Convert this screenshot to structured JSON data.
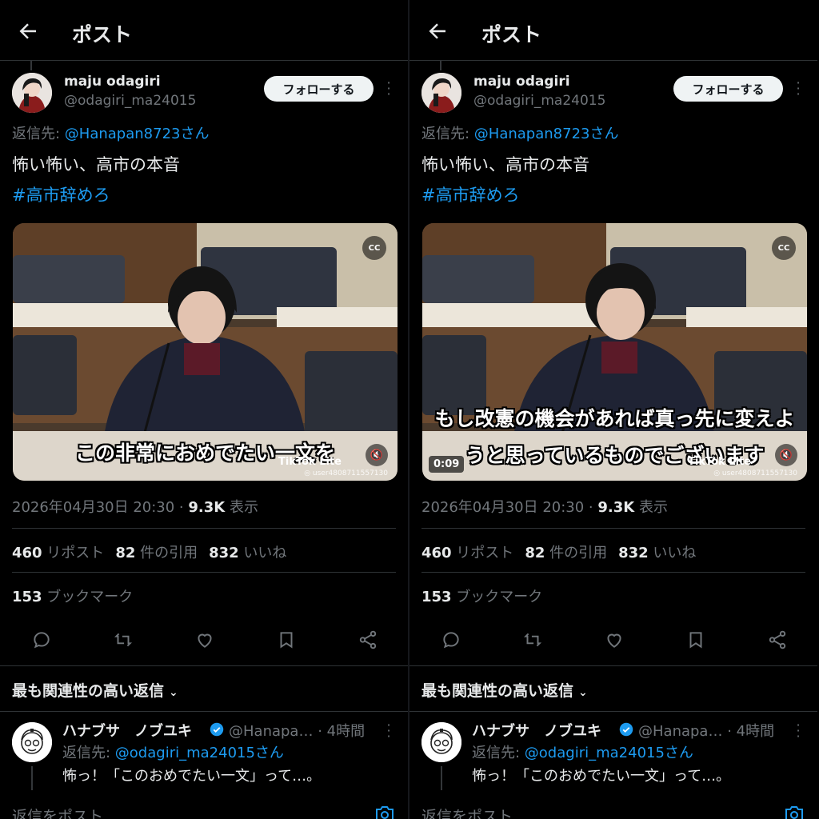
{
  "header": {
    "title": "ポスト"
  },
  "post": {
    "display_name": "maju odagiri",
    "handle": "@odagiri_ma24015",
    "follow_label": "フォローする",
    "reply_to_prefix": "返信先: ",
    "reply_to_mention": "@Hanapan8723さん",
    "text": "怖い怖い、高市の本音",
    "hashtag": "#高市辞めろ",
    "timestamp": "2026年04月30日 20:30 · ",
    "views_count": "9.3K",
    "views_label": " 表示",
    "reposts_count": "460",
    "reposts_label": " リポスト",
    "quotes_count": "82",
    "quotes_label": " 件の引用",
    "likes_count": "832",
    "likes_label": " いいね",
    "bookmarks_count": "153",
    "bookmarks_label": " ブックマーク"
  },
  "video": {
    "cc_label": "CC",
    "tiktok_label": "TikTok Lite",
    "watermark": "◎ user4808711557130",
    "left": {
      "subtitle_lines": [
        "この非常におめでたい一文を"
      ]
    },
    "right": {
      "subtitle_lines": [
        "もし改憲の機会があれば真っ先に変えよ",
        "うと思っているものでございます"
      ],
      "timecode": "0:09"
    }
  },
  "replies_section": {
    "label": "最も関連性の高い返信"
  },
  "reply": {
    "display_name": "ハナブサ　ノブユキ",
    "handle": "@Hanapa…",
    "time": " · 4時間",
    "reply_to_prefix": "返信先: ",
    "reply_to_mention": "@odagiri_ma24015さん",
    "text": "怖っ！「このおめでたい一文」って…。"
  },
  "composer": {
    "placeholder": "返信をポスト"
  },
  "icons": [
    "back-arrow-icon",
    "more-icon",
    "cc-icon",
    "mute-icon",
    "reply-icon",
    "repost-icon",
    "like-icon",
    "bookmark-icon",
    "share-icon",
    "chevron-down-icon",
    "verified-badge-icon",
    "camera-icon"
  ],
  "colors": {
    "background": "#000000",
    "text": "#e7e9ea",
    "secondary": "#71767b",
    "accent": "#1d9bf0",
    "divider": "#2f3336",
    "follow_button": "#eff3f4"
  }
}
